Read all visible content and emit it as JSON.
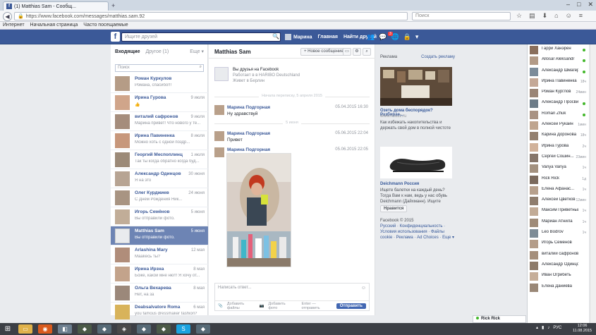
{
  "browser": {
    "tab_title": "(1) Matthias Sam - Сообщ...",
    "url": "https://www.facebook.com/messages/matthias.sam.92",
    "search_placeholder": "Поиск",
    "bookmarks": [
      "Интернет",
      "Начальная страница",
      "Часто посещаемые"
    ]
  },
  "fb_header": {
    "search_placeholder": "Ищите друзей",
    "nav_user": "Марина",
    "nav_home": "Главная",
    "nav_find_friends": "Найти друзей",
    "notifications_badge": "3"
  },
  "left": {
    "inbox_label": "Входящие",
    "other_label": "Другое (1)",
    "more_label": "Еще ▾",
    "search_placeholder": "Поиск",
    "conversations": [
      {
        "name": "Роман Куркулов",
        "date": "",
        "snippet": "Романа, спасибо!!!"
      },
      {
        "name": "Ирина Гурова",
        "date": "9 июля",
        "snippet": "👍"
      },
      {
        "name": "виталий сафронов",
        "date": "9 июля",
        "snippet": "Марина привет! Что нового у те..."
      },
      {
        "name": "Ирина Павиненка",
        "date": "8 июля",
        "snippet": "Можно хоть с одной поздр..."
      },
      {
        "name": "Георгий Меспоплинц",
        "date": "1 июля",
        "snippet": "Так ты когда обратно когда буд..."
      },
      {
        "name": "Александр Одинцов",
        "date": "30 июня",
        "snippet": "Я на это"
      },
      {
        "name": "Олег Курджиев",
        "date": "24 июня",
        "snippet": "С Днем Рождения Ник..."
      },
      {
        "name": "Игорь Семёнов",
        "date": "5 июня",
        "snippet": "Вы отправили фото."
      },
      {
        "name": "Matthias Sam",
        "date": "5 июня",
        "snippet": "Вы отправили фото."
      },
      {
        "name": "Arlashina Mary",
        "date": "12 мая",
        "snippet": "Мааkесь ты?"
      },
      {
        "name": "Ирина Ирзна",
        "date": "8 мая",
        "snippet": "Боже, какой мне ню!!! Я хочу от..."
      },
      {
        "name": "Ольга Вехарева",
        "date": "8 мая",
        "snippet": "Нет, на за"
      },
      {
        "name": "Deabsalvatore Roma",
        "date": "6 мая",
        "snippet": "you famous dressmaker fashion?"
      }
    ]
  },
  "thread": {
    "name": "Matthias Sam",
    "new_message": "+ Новое сообщение",
    "intro_l1": "Вы друзья на Facebook",
    "intro_l2": "Работает в в HARIBO Deutschland",
    "intro_l3": "Живет в Берлин",
    "divider1": "Начала переписку, 5 апреля 2015",
    "divider2": "5 июня",
    "messages": [
      {
        "sender": "Марина Подгорная",
        "date": "05.04.2015 16:30",
        "text": "Ну здравствуй"
      },
      {
        "sender": "Марина Подгорная",
        "date": "05.06.2015 22:04",
        "text": "Привет"
      },
      {
        "sender": "Марина Подгорная",
        "date": "05.06.2015 22:05",
        "text": ""
      }
    ],
    "composer_placeholder": "Написать ответ...",
    "add_files": "Добавить файлы",
    "add_photo": "Добавить фото",
    "enter_hint": "Enter — отправить",
    "send": "Отправить"
  },
  "ads": {
    "title": "Реклама",
    "create": "Создать рекламу",
    "ad1_title": "Озеть дома беспорядок? Разбирае...",
    "ad1_domain": "www.houzz.ru",
    "ad1_text": "Как избежать накопительства и держать свой дом в полной чистоте",
    "ad2_title": "Deichmann Россия",
    "ad2_text": "Ищете балетки на каждый день? Тогда Вам к нам, ведь у нас обувь Deichmann (Дайхманн). Ищите",
    "like": "Нравится",
    "footer_copy": "Facebook © 2015",
    "footer_links": "Русский · Конфиденциальность · Условия использования · Файлы cookie · Реклама · Ad Choices · Еще ▾"
  },
  "chat": {
    "buddies": [
      {
        "name": "Гарри Ханэрен",
        "status": "online"
      },
      {
        "name": "Allosar Aleksandr",
        "status": "online"
      },
      {
        "name": "Александр Шмагер",
        "status": "online"
      },
      {
        "name": "Ирина Павиненка",
        "status": "18ч"
      },
      {
        "name": "Роман Курглов",
        "status": "24мин"
      },
      {
        "name": "Александр Просвир...",
        "status": "online"
      },
      {
        "name": "Roman Zhuk",
        "status": "online"
      },
      {
        "name": "Алексей Рукаин",
        "status": "1мин"
      },
      {
        "name": "Карина Доронова",
        "status": "18ч"
      },
      {
        "name": "Ирина Гурова",
        "status": "2ч"
      },
      {
        "name": "Сергей Сошин...",
        "status": "23мин"
      },
      {
        "name": "Vanya Vanya",
        "status": "1ч"
      },
      {
        "name": "Rick Rick",
        "status": "1д"
      },
      {
        "name": "Елена Афанас...",
        "status": "1ч"
      },
      {
        "name": "Алексей Цветков",
        "status": "12мин"
      },
      {
        "name": "Максим Приветный",
        "status": "1ч"
      },
      {
        "name": "Мариан Атнила",
        "status": "1ч"
      },
      {
        "name": "Leo Bodrov",
        "status": "1ч"
      },
      {
        "name": "Игорь Семенов",
        "status": ""
      },
      {
        "name": "виталий сафронов",
        "status": ""
      },
      {
        "name": "Александр Одинцов",
        "status": ""
      },
      {
        "name": "Иван Огрибеть",
        "status": ""
      },
      {
        "name": "Елена Даниева",
        "status": ""
      }
    ],
    "open_tab": "Rick Rick"
  },
  "taskbar": {
    "lang": "РУС",
    "time": "12:06",
    "date": "11.08.2015"
  }
}
